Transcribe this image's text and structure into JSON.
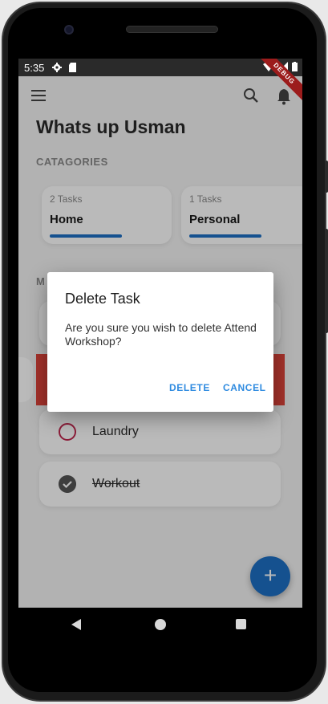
{
  "status_bar": {
    "time": "5:35",
    "debug_label": "DEBUG"
  },
  "app_bar": {
    "icons": [
      "menu-icon",
      "search-icon",
      "bell-icon"
    ]
  },
  "greeting": "Whats up Usman",
  "categories": {
    "title": "CATAGORIES",
    "items": [
      {
        "count": "2 Tasks",
        "name": "Home",
        "progress": 1.0,
        "color": "#1e6fc4"
      },
      {
        "count": "1 Tasks",
        "name": "Personal",
        "progress": 1.0,
        "color": "#1e6fc4"
      }
    ]
  },
  "tasks_section": {
    "title_visible": "M"
  },
  "tasks": [
    {
      "label": "Laundry",
      "done": false,
      "color": "#c0284f"
    },
    {
      "label": "Workout",
      "done": true,
      "color": "#555555"
    }
  ],
  "dialog": {
    "title": "Delete Task",
    "message": "Are you sure you wish to delete Attend Workshop?",
    "delete_label": "DELETE",
    "cancel_label": "CANCEL",
    "accent": "#2f8be0"
  },
  "fab": {
    "label": "+",
    "color": "#1e6fc4"
  },
  "colors": {
    "swipe_delete": "#e0443a",
    "background": "#f4f4f4"
  }
}
